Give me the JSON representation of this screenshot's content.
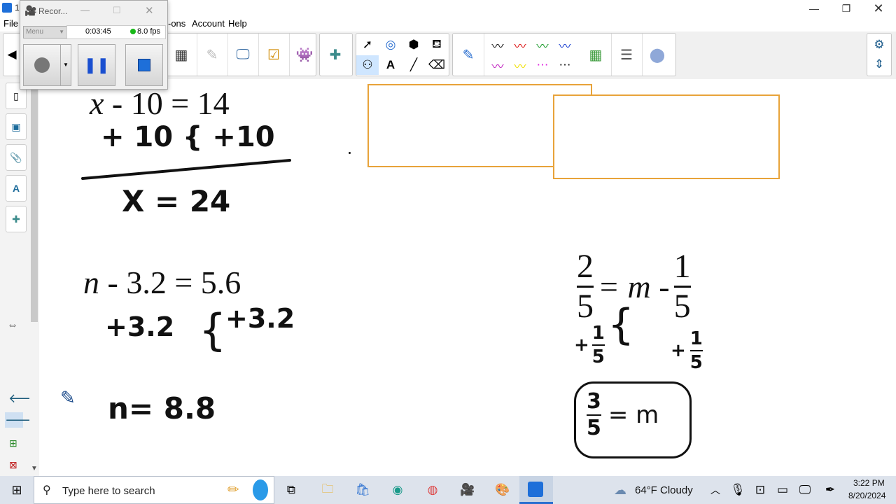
{
  "app": {
    "title_fragment": "1",
    "menus": [
      "File",
      "-ons",
      "Account",
      "Help"
    ]
  },
  "recorder": {
    "title": "Recor...",
    "menu_label": "Menu",
    "elapsed": "0:03:45",
    "fps": "8.0 fps"
  },
  "equations": {
    "eq1": {
      "lhs": "x",
      "rest": " - 10 = 14",
      "work": "+ 10 { +10",
      "result": "X  =  24"
    },
    "eq2": {
      "lhs": "n",
      "rest": " - 3.2 = 5.6",
      "work_left": "+3.2",
      "work_brace": "{",
      "work_right": "+3.2",
      "result": "n=  8.8"
    },
    "eq3": {
      "lhs_num": "2",
      "lhs_den": "5",
      "middle": "= m -",
      "rhs_num": "1",
      "rhs_den": "5",
      "work_left_plus": "+",
      "work_left_num": "1",
      "work_left_den": "5",
      "work_right_plus": "+",
      "work_right_num": "1",
      "work_right_den": "5",
      "answer_num": "3",
      "answer_den": "5",
      "answer_rest": "= m"
    }
  },
  "taskbar": {
    "search_placeholder": "Type here to search",
    "weather": "64°F  Cloudy",
    "time": "3:22 PM",
    "date": "8/20/2024"
  },
  "colors": {
    "box_border": "#e8a33a",
    "toolbar_bg": "#f0f0f0",
    "taskbar_bg": "#dde3ec"
  }
}
